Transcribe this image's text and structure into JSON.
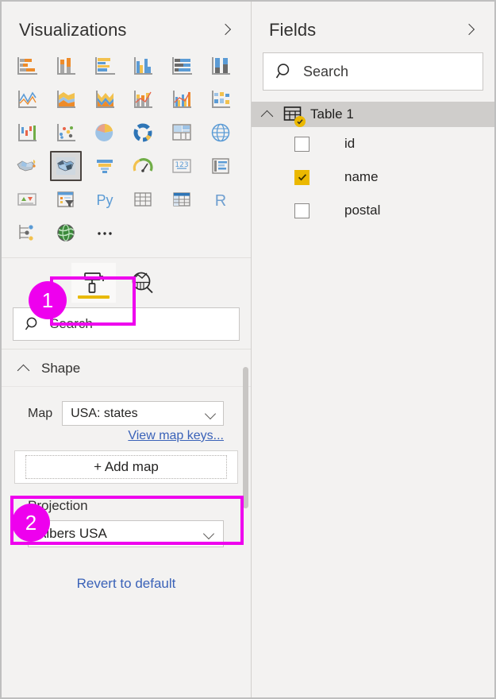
{
  "window": {
    "background": "#f3f2f1",
    "accent_annotation": "#ee00ee",
    "accent_yellow": "#ebb800",
    "link_blue": "#3a62b8"
  },
  "visualizations": {
    "title": "Visualizations",
    "collapse_icon": "chevron-right-icon",
    "gallery": [
      {
        "name": "stacked-bar-chart",
        "label": "Stacked bar chart",
        "selected": false
      },
      {
        "name": "stacked-column-chart",
        "label": "Stacked column chart",
        "selected": false
      },
      {
        "name": "clustered-bar-chart",
        "label": "Clustered bar chart",
        "selected": false
      },
      {
        "name": "clustered-column-chart",
        "label": "Clustered column chart",
        "selected": false
      },
      {
        "name": "100-stacked-bar-chart",
        "label": "100% stacked bar chart",
        "selected": false
      },
      {
        "name": "100-stacked-column-chart",
        "label": "100% stacked column chart",
        "selected": false
      },
      {
        "name": "line-chart",
        "label": "Line chart",
        "selected": false
      },
      {
        "name": "area-chart",
        "label": "Area chart",
        "selected": false
      },
      {
        "name": "stacked-area-chart",
        "label": "Stacked area chart",
        "selected": false
      },
      {
        "name": "line-and-stacked-column-chart",
        "label": "Line and stacked column chart",
        "selected": false
      },
      {
        "name": "line-and-clustered-column-chart",
        "label": "Line and clustered column chart",
        "selected": false
      },
      {
        "name": "ribbon-chart",
        "label": "Ribbon chart",
        "selected": false
      },
      {
        "name": "waterfall-chart",
        "label": "Waterfall chart",
        "selected": false
      },
      {
        "name": "scatter-chart",
        "label": "Scatter chart",
        "selected": false
      },
      {
        "name": "pie-chart",
        "label": "Pie chart",
        "selected": false
      },
      {
        "name": "donut-chart",
        "label": "Donut chart",
        "selected": false
      },
      {
        "name": "treemap",
        "label": "Treemap",
        "selected": false
      },
      {
        "name": "map",
        "label": "Map",
        "selected": false
      },
      {
        "name": "filled-map",
        "label": "Filled map",
        "selected": false
      },
      {
        "name": "shape-map",
        "label": "Shape map",
        "selected": true
      },
      {
        "name": "funnel-chart",
        "label": "Funnel",
        "selected": false
      },
      {
        "name": "gauge-chart",
        "label": "Gauge",
        "selected": false
      },
      {
        "name": "card",
        "label": "Card",
        "selected": false
      },
      {
        "name": "multi-row-card",
        "label": "Multi-row card",
        "selected": false
      },
      {
        "name": "kpi",
        "label": "KPI",
        "selected": false
      },
      {
        "name": "slicer",
        "label": "Slicer",
        "selected": false
      },
      {
        "name": "python-visual",
        "label": "Py",
        "selected": false
      },
      {
        "name": "table-visual",
        "label": "Table",
        "selected": false
      },
      {
        "name": "matrix-visual",
        "label": "Matrix",
        "selected": false
      },
      {
        "name": "r-script-visual",
        "label": "R",
        "selected": false
      },
      {
        "name": "decomposition-tree",
        "label": "Decomposition tree",
        "selected": false
      },
      {
        "name": "arcgis-maps",
        "label": "ArcGIS Maps",
        "selected": false
      },
      {
        "name": "more-options",
        "label": "...",
        "selected": false
      }
    ]
  },
  "pane_tabs": {
    "format_tab": {
      "icon": "paint-roller-icon",
      "label": "Format",
      "active": true
    },
    "analytics_tab": {
      "icon": "analytics-magnifier-icon",
      "label": "Analytics",
      "active": false
    }
  },
  "format_search": {
    "icon": "search-icon",
    "placeholder": "Search",
    "value": "Search"
  },
  "shape_section": {
    "title": "Shape",
    "collapse_icon": "chevron-up-icon",
    "map_label": "Map",
    "map_value": "USA: states",
    "map_options": [
      "USA: states"
    ],
    "view_map_keys_link": "View map keys...",
    "add_map_button": "+ Add map",
    "projection_label": "Projection",
    "projection_value": "Albers USA",
    "projection_options": [
      "Albers USA"
    ],
    "revert_link": "Revert to default"
  },
  "fields": {
    "title": "Fields",
    "collapse_icon": "chevron-right-icon",
    "search": {
      "icon": "search-icon",
      "placeholder": "Search",
      "value": "Search"
    },
    "table": {
      "name": "Table 1",
      "icon": "table-icon",
      "badge_icon": "check-badge-icon",
      "expanded": true,
      "columns": [
        {
          "label": "id",
          "checked": false
        },
        {
          "label": "name",
          "checked": true
        },
        {
          "label": "postal",
          "checked": false
        }
      ]
    }
  },
  "annotations": [
    {
      "name": "callout-1",
      "number": "1",
      "target": "format-tab"
    },
    {
      "name": "callout-2",
      "number": "2",
      "target": "add-map-button"
    }
  ]
}
